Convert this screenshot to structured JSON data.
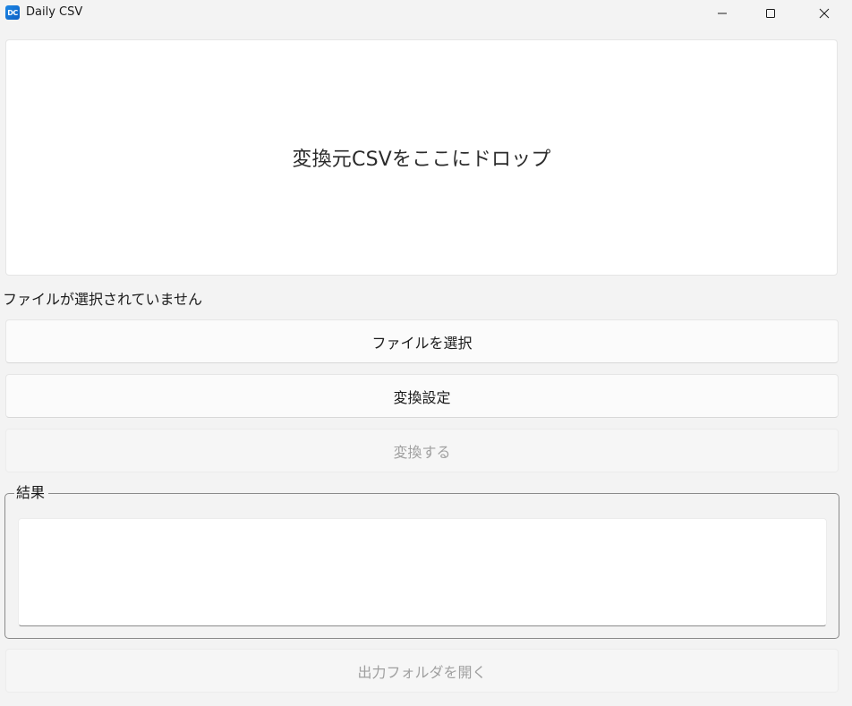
{
  "window": {
    "title": "Daily CSV",
    "icon_text": "DC",
    "icon_color": "#1e88e5",
    "controls": {
      "minimize": "minimize-icon",
      "maximize": "maximize-icon",
      "close": "close-icon"
    }
  },
  "dropzone": {
    "label": "変換元CSVをここにドロップ"
  },
  "status": {
    "selected_file": "ファイルが選択されていません"
  },
  "buttons": {
    "select_file": "ファイルを選択",
    "convert_settings": "変換設定",
    "convert": "変換する",
    "open_output_folder": "出力フォルダを開く"
  },
  "result": {
    "group_label": "結果",
    "text": ""
  }
}
